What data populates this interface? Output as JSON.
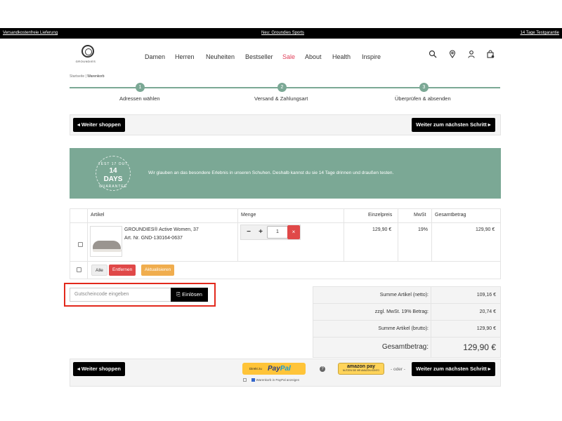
{
  "topbar": {
    "left": "Versandkostenfreie Lieferung",
    "center": "Neu: Groundies Sports",
    "right": "14 Tage Testgarantie"
  },
  "brand": {
    "name": "GROUNDIES"
  },
  "nav": {
    "items": [
      "Damen",
      "Herren",
      "Neuheiten",
      "Bestseller",
      "Sale",
      "About",
      "Health",
      "Inspire"
    ]
  },
  "header_icons": [
    "search-icon",
    "location-icon",
    "user-icon",
    "cart-icon"
  ],
  "breadcrumb": {
    "home": "Startseite",
    "separator": "|",
    "current": "Warenkorb"
  },
  "steps": [
    {
      "number": "1",
      "label": "Adressen wählen"
    },
    {
      "number": "2",
      "label": "Versand & Zahlungsart"
    },
    {
      "number": "3",
      "label": "Überprüfen & absenden"
    }
  ],
  "actions": {
    "continue_shopping": "◂ Weiter shoppen",
    "next_step": "Weiter zum nächsten Schritt ▸"
  },
  "banner": {
    "badge_top": "TEST 17 OUT",
    "badge_mid_1": "14",
    "badge_mid_2": "DAYS",
    "badge_bottom": "GUARANTEE",
    "text": "Wir glauben an das besondere Erlebnis in unseren Schuhen. Deshalb kannst du sie 14 Tage drinnen und draußen testen."
  },
  "cart": {
    "headers": {
      "article": "Artikel",
      "quantity": "Menge",
      "unit_price": "Einzelpreis",
      "vat": "MwSt",
      "total": "Gesamtbetrag"
    },
    "items": [
      {
        "name": "GROUNDIES® Active Women, 37",
        "article_no": "Art. Nr. GND-130164-0637",
        "quantity": "1",
        "unit_price": "129,90 €",
        "vat": "19%",
        "total": "129,90 €"
      }
    ],
    "bulk": {
      "all": "Alle",
      "remove": "Entfernen",
      "update": "Aktualisieren"
    },
    "qty_minus": "−",
    "qty_plus": "+",
    "delete_icon": "×"
  },
  "voucher": {
    "placeholder": "Gutscheincode eingeben",
    "button": "⎘ Einlösen"
  },
  "summary": {
    "rows": [
      {
        "label": "Summe Artikel (netto):",
        "value": "109,16 €"
      },
      {
        "label": "zzgl. MwSt. 19% Betrag:",
        "value": "20,74 €"
      },
      {
        "label": "Summe Artikel (brutto):",
        "value": "129,90 €"
      }
    ],
    "total_label": "Gesamtbetrag:",
    "total_value": "129,90 €"
  },
  "payment": {
    "paypal_small": "Direkt zu",
    "paypal_pay": "Pay",
    "paypal_pal": "Pal",
    "paypal_checkbox_label": "Warenkorb in PayPal anzeigen",
    "amazon_big": "amazon pay",
    "amazon_small": "NUTZEN SIE IHR AMAZON-KONTO",
    "help": "?",
    "or": "- oder -"
  },
  "colors": {
    "accent": "#7ba895",
    "danger": "#e04848",
    "warning": "#f0ad4e",
    "sale": "#e0405a",
    "highlight": "#e2291c"
  }
}
